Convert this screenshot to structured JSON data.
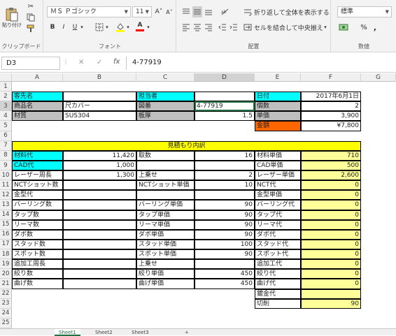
{
  "ribbon": {
    "clipboard": {
      "paste_label": "貼り付け",
      "group_label": "クリップボード"
    },
    "font": {
      "font_name": "ＭＳ Ｐゴシック",
      "font_size": "11",
      "grow_label": "A˄",
      "shrink_label": "A˅",
      "bold": "B",
      "italic": "I",
      "underline": "U",
      "underline_arrow": "▾",
      "border_arrow": "▾",
      "fill_arrow": "▾",
      "fontcolor_letter": "A",
      "fontcolor_arrow": "▾",
      "group_label": "フォント"
    },
    "alignment": {
      "wrap_label": "折り返して全体を表示する",
      "merge_label": "セルを結合して中央揃え",
      "merge_arrow": "▾",
      "group_label": "配置"
    },
    "number": {
      "format_value": "標準",
      "percent": "%",
      "comma": ",",
      "group_label": "数値"
    }
  },
  "formula_bar": {
    "name_box": "D3",
    "cancel": "✕",
    "enter": "✓",
    "fx": "fx",
    "content": "4-77919"
  },
  "columns": [
    "A",
    "B",
    "C",
    "D",
    "E",
    "F",
    "G"
  ],
  "rows": [
    "1",
    "2",
    "3",
    "4",
    "5",
    "6",
    "7",
    "8",
    "9",
    "10",
    "11",
    "12",
    "13",
    "14",
    "15",
    "16",
    "17",
    "18",
    "19",
    "20",
    "21",
    "22",
    "23",
    "24",
    "25"
  ],
  "cells": {
    "a2": "客先名",
    "c2": "担当者",
    "e2": "日付",
    "f2": "2017年6月1日",
    "a3": "商品名",
    "b3": "尺カバー",
    "c3": "図番",
    "d3": "4-77919",
    "e3": "個数",
    "f3": "2",
    "a4": "材質",
    "b4": "SUS304",
    "c4": "板厚",
    "d4": "1.5",
    "e4": "単価",
    "f4": "3,900",
    "e5": "金額",
    "f5": "¥7,800",
    "title7": "見積もり内訳",
    "a8": "材料代",
    "b8": "11,420",
    "c8": "取数",
    "d8": "16",
    "e8": "材料単価",
    "f8": "710",
    "a9": "CAD代",
    "b9": "1,000",
    "e9": "CAD単価",
    "f9": "500",
    "a10": "レーザー周長",
    "b10": "1,300",
    "c10": "上乗せ",
    "d10": "2",
    "e10": "レーザー単価",
    "f10": "2,600",
    "a11": "NCTショット数",
    "c11": "NCTショット単価",
    "d11": "10",
    "e11": "NCT代",
    "f11": "0",
    "a12": "金型代",
    "e12": "金型単価",
    "f12": "0",
    "a13": "バーリング数",
    "c13": "バーリング単価",
    "d13": "90",
    "e13": "バーリング代",
    "f13": "0",
    "a14": "タップ数",
    "c14": "タップ単価",
    "d14": "90",
    "e14": "タップ代",
    "f14": "0",
    "a15": "リーマ数",
    "c15": "リーマ単価",
    "d15": "90",
    "e15": "リーマ代",
    "f15": "0",
    "a16": "ダボ数",
    "c16": "ダボ単価",
    "d16": "90",
    "e16": "ダボ代",
    "f16": "0",
    "a17": "スタッド数",
    "c17": "スタッド単価",
    "d17": "100",
    "e17": "スタッド代",
    "f17": "0",
    "a18": "スポット数",
    "c18": "スポット単価",
    "d18": "90",
    "e18": "スポット代",
    "f18": "0",
    "a19": "追加工周長",
    "c19": "上乗せ",
    "e19": "追加工代",
    "f19": "0",
    "a20": "絞り数",
    "c20": "絞り単価",
    "d20": "450",
    "e20": "絞り代",
    "f20": "0",
    "a21": "曲げ数",
    "c21": "曲げ単価",
    "d21": "450",
    "e21": "曲げ代",
    "f21": "0",
    "e22": "鍍金代",
    "e23": "切削",
    "f23": "90"
  },
  "sheet_tabs": [
    "Sheet1",
    "Sheet2",
    "Sheet3"
  ],
  "add_sheet": "+",
  "colors": {
    "cyan": "#00ffff",
    "gray": "#bfbfbf",
    "yellow": "#ffff00",
    "light_yellow": "#ffff99",
    "orange": "#ff6600",
    "excel_green": "#217346"
  }
}
